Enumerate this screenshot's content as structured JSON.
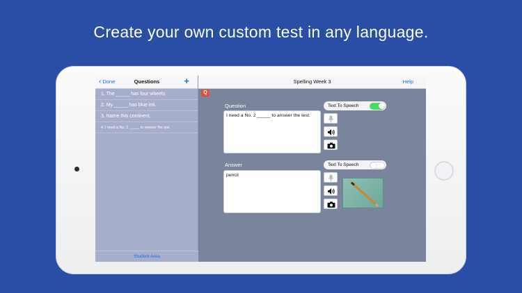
{
  "headline": "Create your own custom test in any language.",
  "left_panel": {
    "back_label": "Done",
    "title": "Questions",
    "add_label": "+",
    "questions": [
      "1. The _____ has four wheels.",
      "2. My _____ has blue ink.",
      "3. Name this continent.",
      "4. I need a No. 2 _____ to answer the test."
    ],
    "footer": "Student Area"
  },
  "right_panel": {
    "title": "Spelling Week 3",
    "help_label": "Help",
    "badge": "Q",
    "question_label": "Question",
    "question_text": "I need a No. 2 _____ to answer the test.",
    "answer_label": "Answer",
    "answer_text": "pencil",
    "tts_label": "Text To Speech",
    "question_tts_on": true,
    "answer_tts_on": false
  },
  "icons": [
    "chevron-left-icon",
    "plus-icon",
    "microphone-icon",
    "speaker-icon",
    "camera-icon"
  ],
  "colors": {
    "background": "#2a4ea6",
    "accent": "#1d6fe0",
    "toggle_on": "#4cd964",
    "badge": "#e2502f"
  }
}
